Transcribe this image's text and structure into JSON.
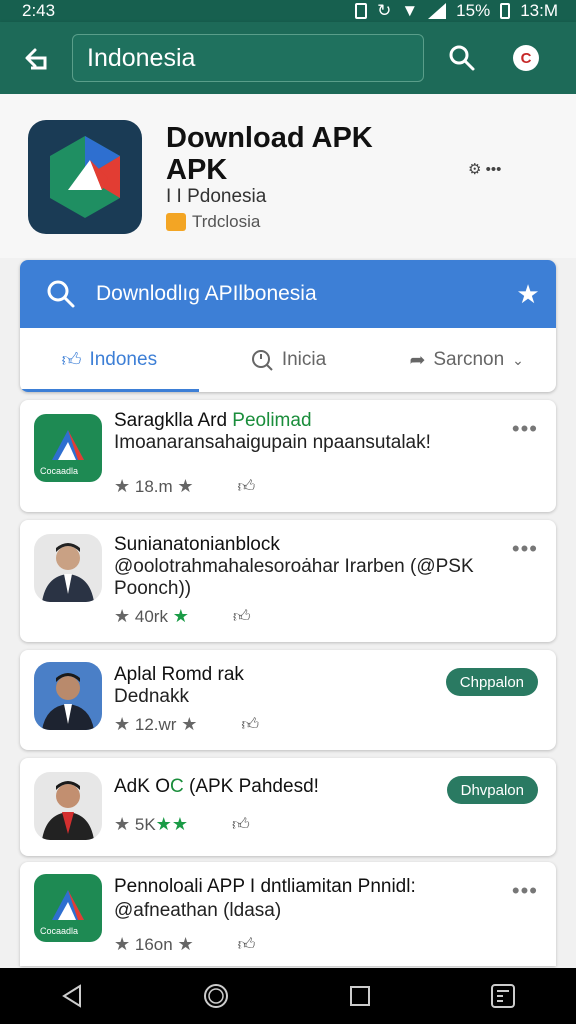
{
  "status": {
    "time": "2:43",
    "battery": "15%",
    "clock": "13:M"
  },
  "appbar": {
    "search_value": "Indonesia"
  },
  "header": {
    "title": "Download APK APK",
    "sub1": "I I Pdonesia",
    "sub2": "Trdclosia",
    "side": "⚙ •••"
  },
  "search_card": {
    "placeholder": "Downlodlıg APIlbonesia",
    "tabs": [
      {
        "label": "Indones"
      },
      {
        "label": "Inicia"
      },
      {
        "label": "Sarcnon"
      }
    ]
  },
  "items": [
    {
      "title": "Saragklla Ard ",
      "title_green": "Peolimad",
      "desc": "Imoanaransahaigupain npaansutalak!",
      "stat": "18.m",
      "thumb": "Cocaadla",
      "action": "•••"
    },
    {
      "title": "Sunianatonianblock",
      "desc": "@oolotrahmahalesoroȧhar Irarben (@PSK Poonch))",
      "stat": "40rk",
      "action": "•••"
    },
    {
      "title": "Aplal Romd rak",
      "desc": "Dednakk",
      "stat": "12.wr",
      "action": "Chppalon"
    },
    {
      "title": "AdK O",
      "title_green": "C",
      "title_rest": " (APK Pahdesd!",
      "desc": "",
      "stat": "5K",
      "action": "Dhvpalon"
    },
    {
      "title": "Pennoloali APP I dntliamitan Pnnidl:",
      "desc": "@afneathan (ldasa)",
      "stat": "16on",
      "thumb": "Cocaadla",
      "action": "•••"
    }
  ],
  "colors": {
    "primary": "#1d6a58",
    "accent": "#3d7fd6",
    "green": "#1a9b46"
  }
}
